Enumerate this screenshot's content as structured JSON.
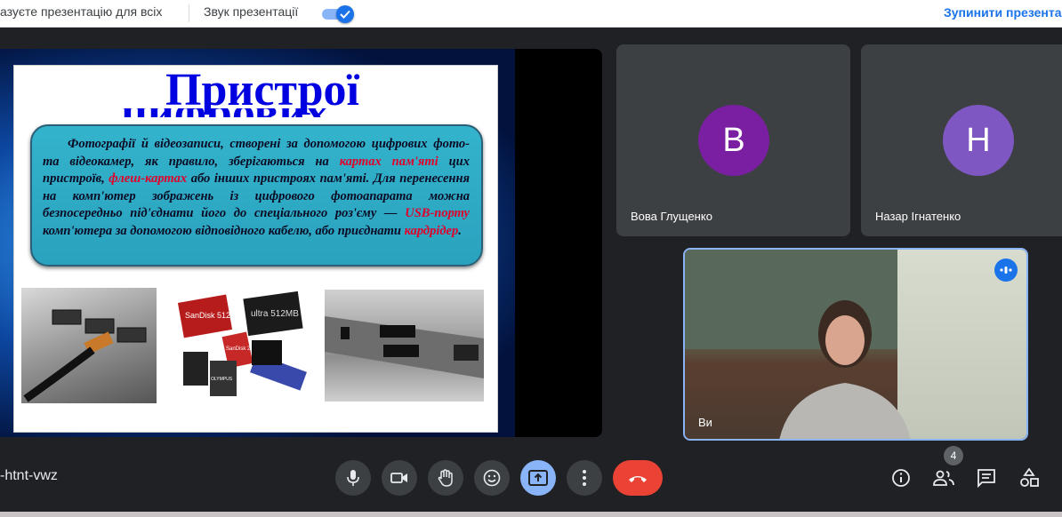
{
  "topbar": {
    "message": "азуєте презентацію для всіх",
    "audio_label": "Звук презентації",
    "stop_label": "Зупинити презента"
  },
  "slide": {
    "title": "Пристрої",
    "title2": "цифрових",
    "text_parts": [
      "Фотографії й відеозаписи, створені за допомогою цифрових фото- та відеокамер, як правило, зберігаються на ",
      "картах пам'яті",
      " цих пристроїв, ",
      "флеш-картах",
      " або інших пристроях пам'яті. Для перенесення на комп'ютер зображень із цифрового фотоапарата можна безпосередньо під'єднати його до спеціального роз'єму — ",
      "USB-порту",
      " комп'ютера за допомогою відповідного кабелю, або приєднати ",
      "кардрідер",
      "."
    ],
    "card_labels": [
      "SanDisk 512MB",
      "ultra 512MB",
      "SanDisk 256MB",
      "OLYMPUS"
    ]
  },
  "participants": [
    {
      "initial": "В",
      "name": "Вова Глущенко",
      "color": "#7b1fa2"
    },
    {
      "initial": "Н",
      "name": "Назар Ігнатенко",
      "color": "#7e57c2"
    }
  ],
  "self_view": {
    "name": "Ви"
  },
  "bottombar": {
    "meeting_code": "-htnt-vwz",
    "participants_count": "4"
  },
  "icons": [
    "share-icon",
    "mic-icon",
    "camera-icon",
    "hand-icon",
    "emoji-icon",
    "present-icon",
    "more-icon",
    "hangup-icon",
    "info-icon",
    "people-icon",
    "chat-icon",
    "activities-icon",
    "speaking-icon",
    "check-icon"
  ]
}
